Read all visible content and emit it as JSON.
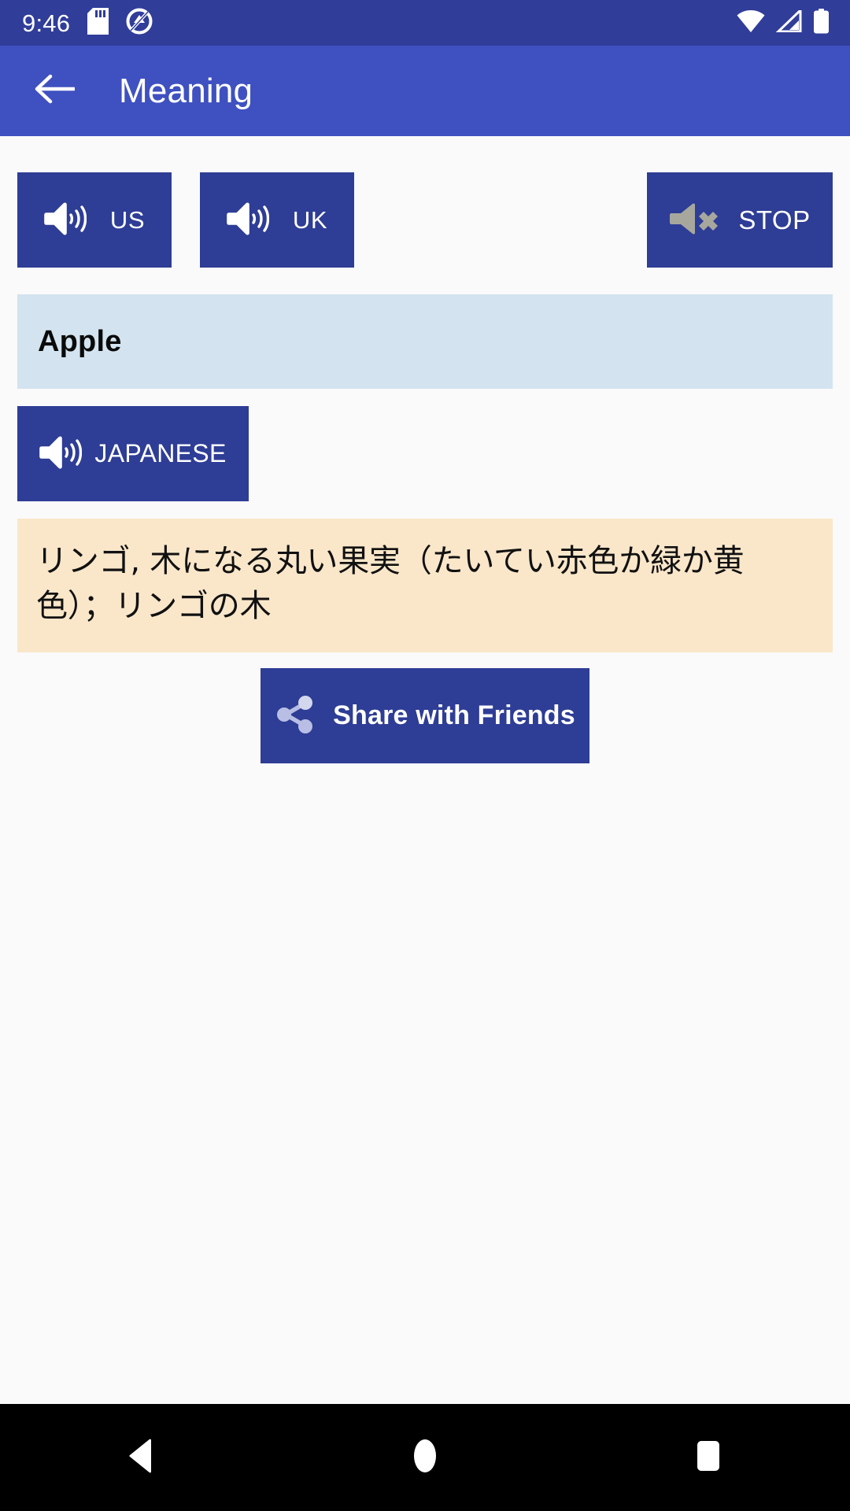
{
  "status_bar": {
    "time": "9:46",
    "icons_left": [
      "sd-card-icon",
      "do-not-disturb-icon"
    ],
    "icons_right": [
      "wifi-icon",
      "cellular-signal-icon",
      "battery-icon"
    ],
    "background_color": "#303D99",
    "foreground_color": "#FFFFFF"
  },
  "app_bar": {
    "back_icon": "back-arrow-icon",
    "title": "Meaning",
    "background_color": "#3F51C0"
  },
  "theme": {
    "button_blue": "#2E3D95",
    "word_box_blue": "#D3E3EF",
    "definition_cream": "#FAE7CA",
    "page_background": "#FAFAFA",
    "nav_bar_black": "#000000",
    "muted_icon_gray": "#A7A79E"
  },
  "pronunciation": {
    "us_button": {
      "label": "US",
      "icon": "volume-up-icon"
    },
    "uk_button": {
      "label": "UK",
      "icon": "volume-up-icon"
    },
    "stop_button": {
      "label": "STOP",
      "icon": "volume-mute-icon"
    }
  },
  "word": {
    "text": "Apple"
  },
  "translation": {
    "speak_button": {
      "label": "JAPANESE",
      "icon": "volume-up-icon"
    },
    "definition": "リンゴ, 木になる丸い果実（たいてい赤色か緑か黄色）；リンゴの木"
  },
  "share": {
    "label": "Share with Friends",
    "icon": "share-nodes-icon"
  },
  "nav_bar": {
    "back": "back-triangle-icon",
    "home": "home-circle-icon",
    "recents": "recents-square-icon"
  }
}
